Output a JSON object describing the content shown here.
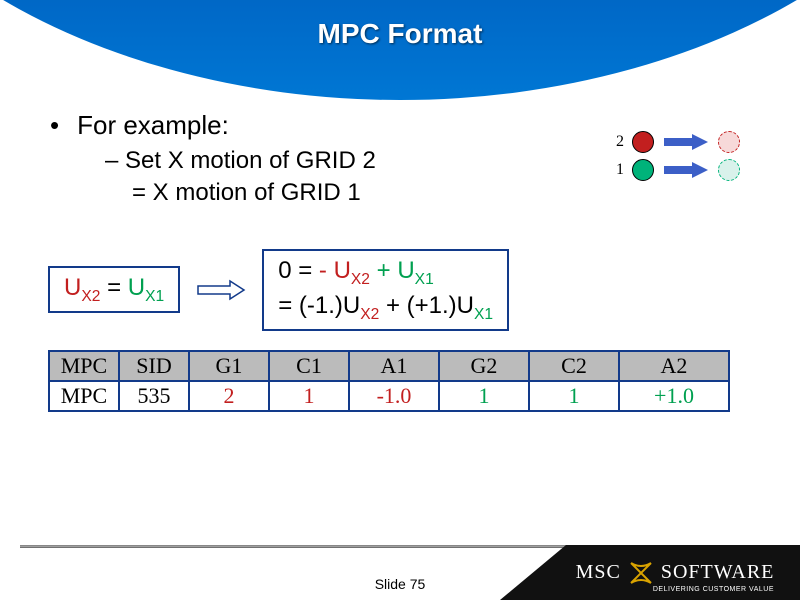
{
  "slide": {
    "title": "MPC Format",
    "bullet1": "For example:",
    "bullet2": "Set X motion of GRID 2",
    "bullet3": "=  X motion of GRID 1",
    "slide_number": "Slide 75"
  },
  "legend": {
    "label2": "2",
    "label1": "1"
  },
  "equation": {
    "lhs_prefix": "U",
    "lhs_sub1": "X2",
    "eq": " = ",
    "rhs_prefix": "U",
    "rhs_sub1": "X1",
    "expand_line1_a": "0 = ",
    "expand_line1_b": "  - U",
    "expand_line1_c": "X2",
    "expand_line1_d": "  +  U",
    "expand_line1_e": "X1",
    "expand_line2_a": "   =   (-1.)U",
    "expand_line2_b": "X2",
    "expand_line2_c": " + (+1.)U",
    "expand_line2_d": "X1"
  },
  "table": {
    "headers": [
      "MPC",
      "SID",
      "G1",
      "C1",
      "A1",
      "G2",
      "C2",
      "A2"
    ],
    "row": [
      "MPC",
      "535",
      "2",
      "1",
      "-1.0",
      "1",
      "1",
      "+1.0"
    ],
    "colors": [
      "",
      "",
      "red",
      "red",
      "red",
      "green",
      "green",
      "green"
    ]
  },
  "footer": {
    "brand_left": "MSC",
    "brand_right": "SOFTWARE",
    "tagline": "DELIVERING CUSTOMER VALUE"
  }
}
